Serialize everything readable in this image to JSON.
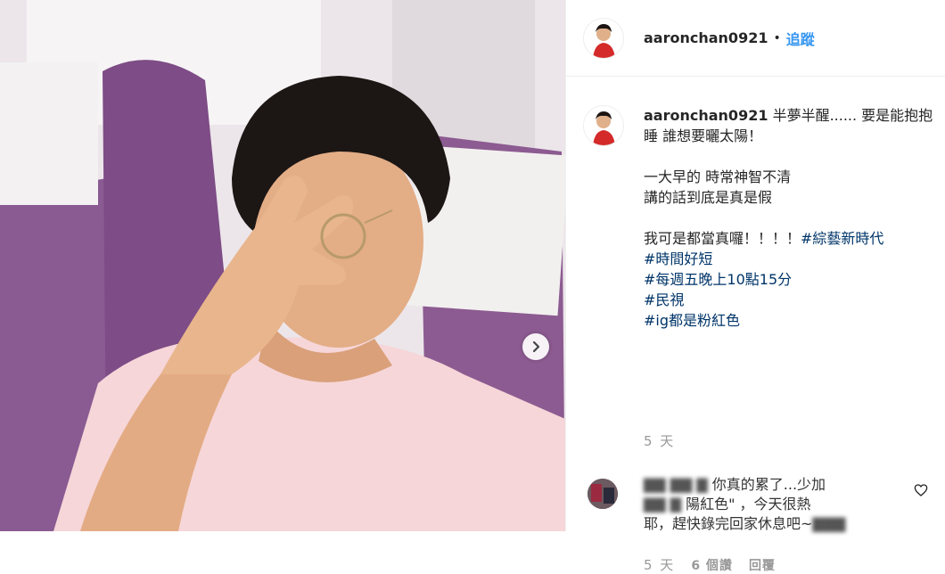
{
  "post": {
    "username": "aaronchan0921",
    "separator": "•",
    "follow_label": "追蹤"
  },
  "caption": {
    "username": "aaronchan0921",
    "line1": "半夢半醒...... 要是能抱抱睡 誰想要曬太陽！",
    "line2": "一大早的 時常神智不清",
    "line3": "講的話到底是真是假",
    "line4": "我可是都當真囉！！！！",
    "hashtags": [
      "#綜藝新時代",
      "#時間好短",
      "#每週五晚上10點15分",
      "#民視",
      "#ig都是粉紅色"
    ],
    "time": "5 天"
  },
  "comment": {
    "text_visible_1": "你真的累了...少加",
    "text_visible_2": "陽紅色\" ，今天很熱",
    "text_visible_3": "耶，趕快錄完回家休息吧~",
    "time": "5 天",
    "likes": "6 個讚",
    "reply_label": "回覆"
  },
  "icons": {
    "carousel_next": "chevron-right-icon",
    "like": "heart-icon"
  },
  "colors": {
    "link": "#003569",
    "follow": "#3897f0",
    "meta": "#999999"
  }
}
